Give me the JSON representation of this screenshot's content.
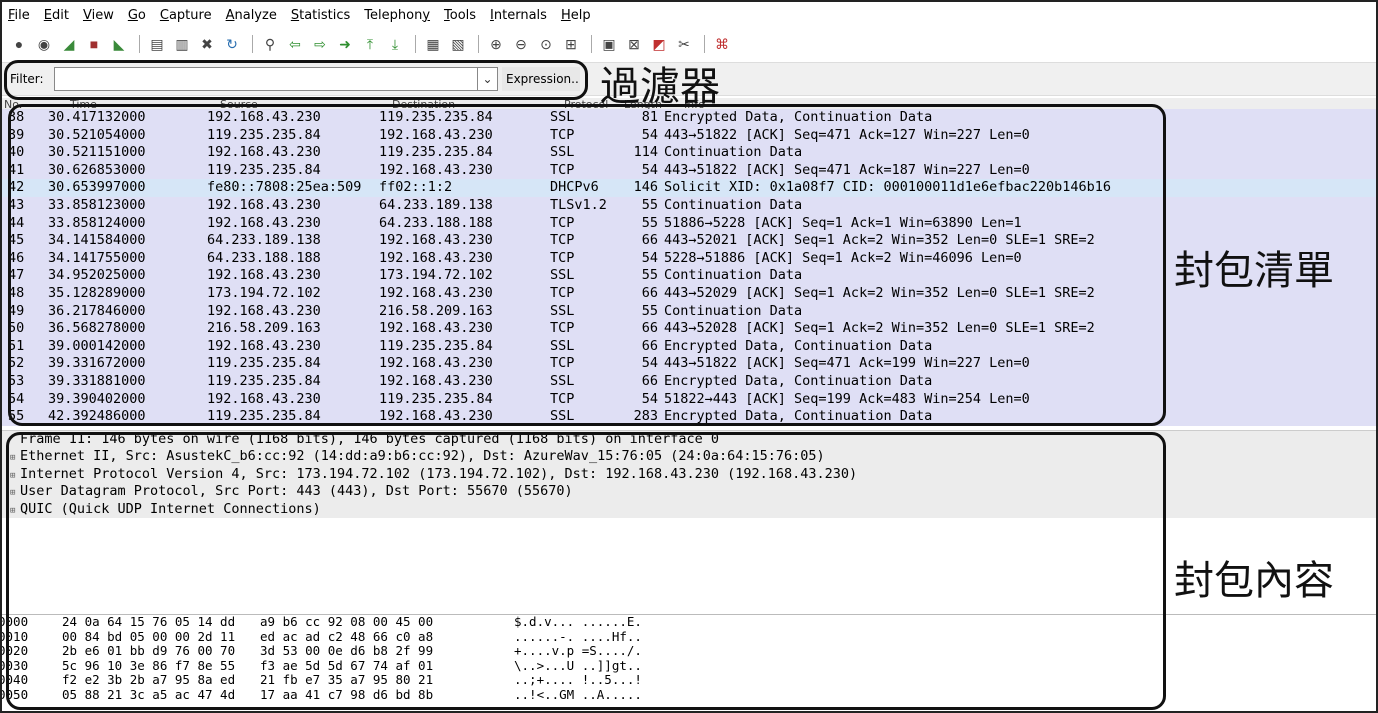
{
  "menu": [
    {
      "key": "F",
      "rest": "ile"
    },
    {
      "key": "E",
      "rest": "dit"
    },
    {
      "key": "V",
      "rest": "iew"
    },
    {
      "key": "G",
      "rest": "o"
    },
    {
      "key": "C",
      "rest": "apture"
    },
    {
      "key": "A",
      "rest": "nalyze"
    },
    {
      "key": "S",
      "rest": "tatistics"
    },
    {
      "pre": "Telephon",
      "key": "y",
      "rest": ""
    },
    {
      "key": "T",
      "rest": "ools"
    },
    {
      "key": "I",
      "rest": "nternals"
    },
    {
      "key": "H",
      "rest": "elp"
    }
  ],
  "filter": {
    "label": "Filter:",
    "value": "",
    "expression_label": "Expression.."
  },
  "annotations": {
    "filter": "過濾器",
    "packet_list": "封包清單",
    "packet_details": "封包內容"
  },
  "packet_list": {
    "columns": [
      "No.",
      "Time",
      "Source",
      "Destination",
      "Protocol",
      "Length",
      "Info"
    ],
    "rows": [
      [
        "38",
        "30.417132000",
        "192.168.43.230",
        "119.235.235.84",
        "SSL",
        "81",
        "Encrypted Data, Continuation Data"
      ],
      [
        "39",
        "30.521054000",
        "119.235.235.84",
        "192.168.43.230",
        "TCP",
        "54",
        "443→51822 [ACK] Seq=471 Ack=127 Win=227 Len=0"
      ],
      [
        "40",
        "30.521151000",
        "192.168.43.230",
        "119.235.235.84",
        "SSL",
        "114",
        "Continuation Data"
      ],
      [
        "41",
        "30.626853000",
        "119.235.235.84",
        "192.168.43.230",
        "TCP",
        "54",
        "443→51822 [ACK] Seq=471 Ack=187 Win=227 Len=0"
      ],
      [
        "42",
        "30.653997000",
        "fe80::7808:25ea:509",
        "ff02::1:2",
        "DHCPv6",
        "146",
        "Solicit XID: 0x1a08f7 CID: 000100011d1e6efbac220b146b16"
      ],
      [
        "43",
        "33.858123000",
        "192.168.43.230",
        "64.233.189.138",
        "TLSv1.2",
        "55",
        "Continuation Data"
      ],
      [
        "44",
        "33.858124000",
        "192.168.43.230",
        "64.233.188.188",
        "TCP",
        "55",
        "51886→5228 [ACK] Seq=1 Ack=1 Win=63890 Len=1"
      ],
      [
        "45",
        "34.141584000",
        "64.233.189.138",
        "192.168.43.230",
        "TCP",
        "66",
        "443→52021 [ACK] Seq=1 Ack=2 Win=352 Len=0 SLE=1 SRE=2"
      ],
      [
        "46",
        "34.141755000",
        "64.233.188.188",
        "192.168.43.230",
        "TCP",
        "54",
        "5228→51886 [ACK] Seq=1 Ack=2 Win=46096 Len=0"
      ],
      [
        "47",
        "34.952025000",
        "192.168.43.230",
        "173.194.72.102",
        "SSL",
        "55",
        "Continuation Data"
      ],
      [
        "48",
        "35.128289000",
        "173.194.72.102",
        "192.168.43.230",
        "TCP",
        "66",
        "443→52029 [ACK] Seq=1 Ack=2 Win=352 Len=0 SLE=1 SRE=2"
      ],
      [
        "49",
        "36.217846000",
        "192.168.43.230",
        "216.58.209.163",
        "SSL",
        "55",
        "Continuation Data"
      ],
      [
        "50",
        "36.568278000",
        "216.58.209.163",
        "192.168.43.230",
        "TCP",
        "66",
        "443→52028 [ACK] Seq=1 Ack=2 Win=352 Len=0 SLE=1 SRE=2"
      ],
      [
        "51",
        "39.000142000",
        "192.168.43.230",
        "119.235.235.84",
        "SSL",
        "66",
        "Encrypted Data, Continuation Data"
      ],
      [
        "52",
        "39.331672000",
        "119.235.235.84",
        "192.168.43.230",
        "TCP",
        "54",
        "443→51822 [ACK] Seq=471 Ack=199 Win=227 Len=0"
      ],
      [
        "53",
        "39.331881000",
        "119.235.235.84",
        "192.168.43.230",
        "SSL",
        "66",
        "Encrypted Data, Continuation Data"
      ],
      [
        "54",
        "39.390402000",
        "192.168.43.230",
        "119.235.235.84",
        "TCP",
        "54",
        "51822→443 [ACK] Seq=199 Ack=483 Win=254 Len=0"
      ],
      [
        "55",
        "42.392486000",
        "119.235.235.84",
        "192.168.43.230",
        "SSL",
        "283",
        "Encrypted Data, Continuation Data"
      ]
    ],
    "selected_index": 4
  },
  "details": [
    {
      "expandable": false,
      "text": "Frame 11: 146 bytes on wire (1168 bits), 146 bytes captured (1168 bits) on interface 0"
    },
    {
      "expandable": true,
      "text": "Ethernet II, Src: AsustekC_b6:cc:92 (14:dd:a9:b6:cc:92), Dst: AzureWav_15:76:05 (24:0a:64:15:76:05)"
    },
    {
      "expandable": true,
      "text": "Internet Protocol Version 4, Src: 173.194.72.102 (173.194.72.102), Dst: 192.168.43.230 (192.168.43.230)"
    },
    {
      "expandable": true,
      "text": "User Datagram Protocol, Src Port: 443 (443), Dst Port: 55670 (55670)"
    },
    {
      "expandable": true,
      "text": "QUIC (Quick UDP Internet Connections)"
    }
  ],
  "hex": [
    {
      "offset": "0000",
      "bytes1": "24 0a 64 15 76 05 14 dd",
      "bytes2": "a9 b6 cc 92 08 00 45 00",
      "ascii": "$.d.v... ......E."
    },
    {
      "offset": "0010",
      "bytes1": "00 84 bd 05 00 00 2d 11",
      "bytes2": "ed ac ad c2 48 66 c0 a8",
      "ascii": "......-. ....Hf.."
    },
    {
      "offset": "0020",
      "bytes1": "2b e6 01 bb d9 76 00 70",
      "bytes2": "3d 53 00 0e d6 b8 2f 99",
      "ascii": "+....v.p =S..../."
    },
    {
      "offset": "0030",
      "bytes1": "5c 96 10 3e 86 f7 8e 55",
      "bytes2": "f3 ae 5d 5d 67 74 af 01",
      "ascii": "\\..>...U ..]]gt.."
    },
    {
      "offset": "0040",
      "bytes1": "f2 e2 3b 2b a7 95 8a ed",
      "bytes2": "21 fb e7 35 a7 95 80 21",
      "ascii": "..;+.... !..5...!"
    },
    {
      "offset": "0050",
      "bytes1": "05 88 21 3c a5 ac 47 4d",
      "bytes2": "17 aa 41 c7 98 d6 bd 8b",
      "ascii": "..!<..GM ..A....."
    }
  ]
}
